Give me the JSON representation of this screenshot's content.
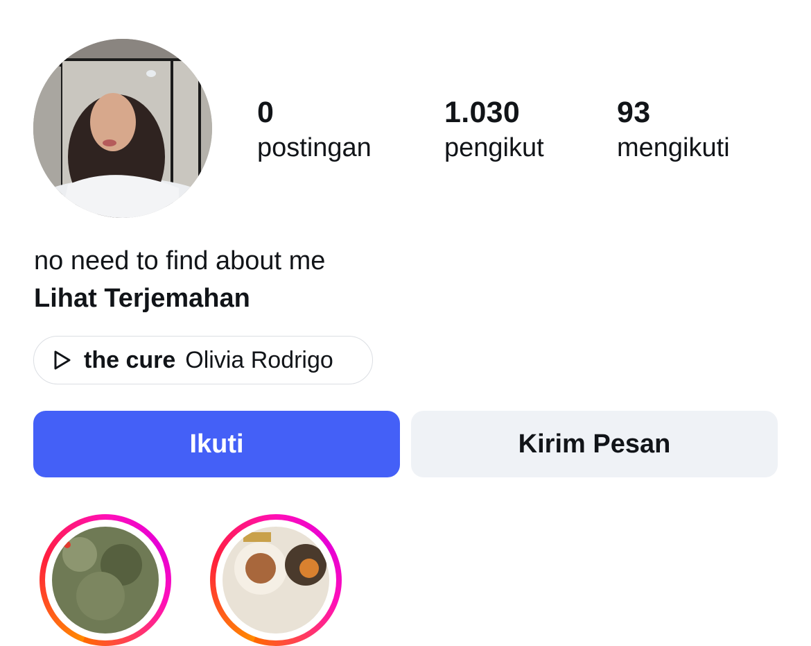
{
  "profile": {
    "stats": [
      {
        "value": "0",
        "label": "postingan"
      },
      {
        "value": "1.030",
        "label": "pengikut"
      },
      {
        "value": "93",
        "label": "mengikuti"
      }
    ],
    "bio": "no need to find about me",
    "translate_label": "Lihat Terjemahan",
    "music": {
      "icon": "play-icon",
      "song": "the cure",
      "artist": "Olivia Rodrigo"
    }
  },
  "actions": {
    "follow_label": "Ikuti",
    "message_label": "Kirim Pesan"
  },
  "colors": {
    "follow_button": "#4460f7",
    "message_button": "#eff2f6",
    "story_ring_start": "#ff8a00",
    "story_ring_end": "#e600d6"
  }
}
